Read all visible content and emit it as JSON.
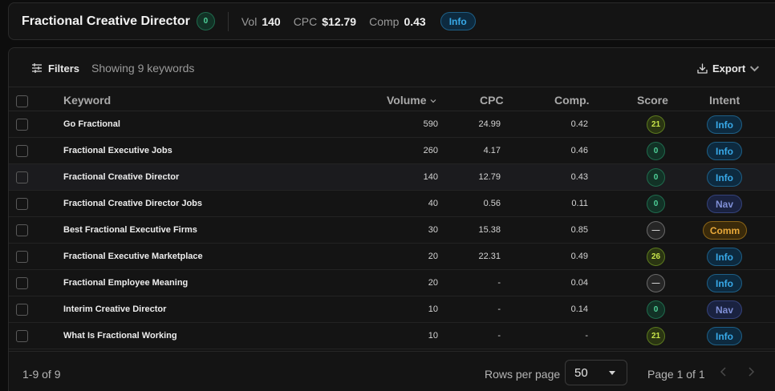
{
  "header": {
    "title": "Fractional Creative Director",
    "badge": "0",
    "vol_label": "Vol",
    "vol_value": "140",
    "cpc_label": "CPC",
    "cpc_value": "$12.79",
    "comp_label": "Comp",
    "comp_value": "0.43",
    "intent": "Info"
  },
  "toolbar": {
    "filters_label": "Filters",
    "showing_text": "Showing 9 keywords",
    "export_label": "Export"
  },
  "columns": {
    "keyword": "Keyword",
    "volume": "Volume",
    "cpc": "CPC",
    "comp": "Comp.",
    "score": "Score",
    "intent": "Intent"
  },
  "rows": [
    {
      "keyword": "Go Fractional",
      "volume": "590",
      "cpc": "24.99",
      "comp": "0.42",
      "score": "21",
      "intent": "Info"
    },
    {
      "keyword": "Fractional Executive Jobs",
      "volume": "260",
      "cpc": "4.17",
      "comp": "0.46",
      "score": "0",
      "intent": "Info"
    },
    {
      "keyword": "Fractional Creative Director",
      "volume": "140",
      "cpc": "12.79",
      "comp": "0.43",
      "score": "0",
      "intent": "Info"
    },
    {
      "keyword": "Fractional Creative Director Jobs",
      "volume": "40",
      "cpc": "0.56",
      "comp": "0.11",
      "score": "0",
      "intent": "Nav"
    },
    {
      "keyword": "Best Fractional Executive Firms",
      "volume": "30",
      "cpc": "15.38",
      "comp": "0.85",
      "score": "—",
      "intent": "Comm"
    },
    {
      "keyword": "Fractional Executive Marketplace",
      "volume": "20",
      "cpc": "22.31",
      "comp": "0.49",
      "score": "26",
      "intent": "Info"
    },
    {
      "keyword": "Fractional Employee Meaning",
      "volume": "20",
      "cpc": "-",
      "comp": "0.04",
      "score": "—",
      "intent": "Info"
    },
    {
      "keyword": "Interim Creative Director",
      "volume": "10",
      "cpc": "-",
      "comp": "0.14",
      "score": "0",
      "intent": "Nav"
    },
    {
      "keyword": "What Is Fractional Working",
      "volume": "10",
      "cpc": "-",
      "comp": "-",
      "score": "21",
      "intent": "Info"
    }
  ],
  "footer": {
    "range": "1-9 of 9",
    "rows_per_page_label": "Rows per page",
    "rows_per_page_value": "50",
    "page_label": "Page 1 of 1"
  },
  "colors": {
    "background": "#0d0d0d",
    "panel": "#141414",
    "info": "#38a9e8",
    "nav": "#7f8fd6",
    "comm": "#e9a93a",
    "score_green": "#4fd39a",
    "score_lime": "#c8e44a"
  },
  "icons": {
    "filters": "sliders-icon",
    "export": "download-icon",
    "sort": "chevron-down-icon",
    "prev": "chevron-left-icon",
    "next": "chevron-right-icon"
  }
}
